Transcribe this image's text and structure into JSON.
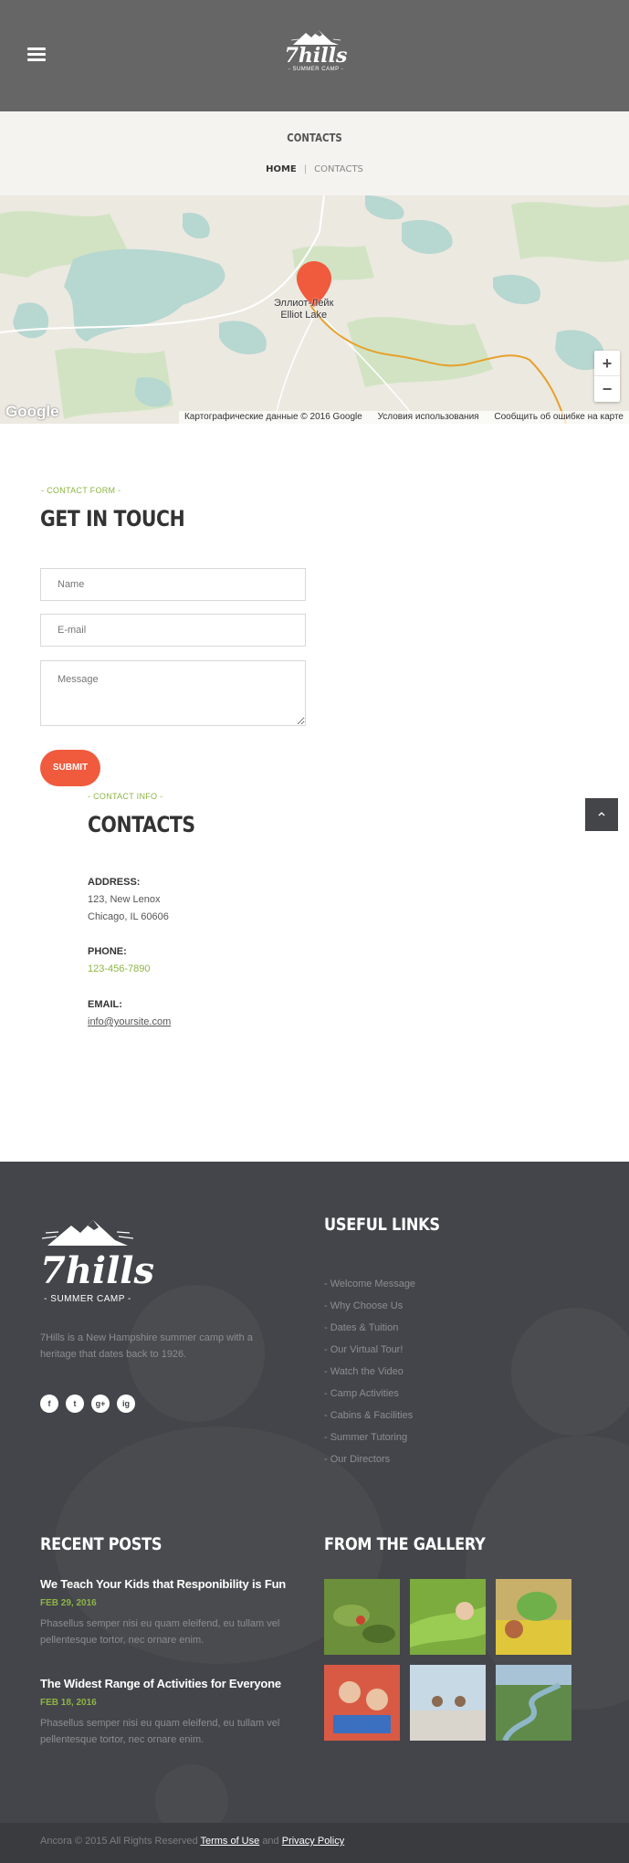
{
  "header": {
    "logo_text": "7hills",
    "logo_sub": "- SUMMER CAMP -"
  },
  "page": {
    "title": "CONTACTS",
    "breadcrumb_home": "HOME",
    "breadcrumb_sep": "|",
    "breadcrumb_current": "CONTACTS"
  },
  "map": {
    "label_ru": "Эллиот-Лейк",
    "label_en": "Elliot Lake",
    "zoom_in": "+",
    "zoom_out": "−",
    "google": "Google",
    "attribution": "Картографические данные © 2016 Google",
    "terms": "Условия использования",
    "report": "Сообщить об ошибке на карте",
    "colors": {
      "water": "#b7d7d1",
      "forest": "#d2e3c3",
      "land": "#ece9e1",
      "road": "#e6a12b",
      "pin": "#f05a3d"
    }
  },
  "contact_form": {
    "tag": "- CONTACT FORM -",
    "heading": "GET IN TOUCH",
    "name_placeholder": "Name",
    "email_placeholder": "E-mail",
    "message_placeholder": "Message",
    "submit_label": "SUBMIT"
  },
  "contact_info": {
    "tag": "- CONTACT INFO -",
    "heading": "CONTACTS",
    "address_label": "ADDRESS:",
    "address_line1": "123, New Lenox",
    "address_line2": "Chicago, IL 60606",
    "phone_label": "PHONE:",
    "phone": "123-456-7890",
    "email_label": "EMAIL:",
    "email": "info@yoursite.com"
  },
  "scroll_top_icon": "chevron-up-icon",
  "footer": {
    "logo_text": "7hills",
    "logo_sub": "- SUMMER CAMP -",
    "description": "7Hills is a New Hampshire summer camp with a heritage that dates back to 1926.",
    "socials": [
      "f",
      "t",
      "g+",
      "ig"
    ],
    "useful_heading": "USEFUL LINKS",
    "links": [
      "- Welcome Message",
      "- Why Choose Us",
      "- Dates & Tuition",
      "- Our Virtual Tour!",
      "- Watch the Video",
      "- Camp Activities",
      "- Cabins & Facilities",
      "- Summer Tutoring",
      "- Our Directors"
    ],
    "recent_heading": "RECENT POSTS",
    "posts": [
      {
        "title": "We Teach Your Kids that Responibility is Fun",
        "date": "FEB 29, 2016",
        "excerpt": "Phasellus semper nisi eu quam eleifend, eu tullam vel pellentesque tortor, nec ornare enim."
      },
      {
        "title": "The Widest Range of Activities for Everyone",
        "date": "FEB 18, 2016",
        "excerpt": "Phasellus semper nisi eu quam eleifend, eu tullam vel pellentesque tortor, nec ornare enim."
      }
    ],
    "gallery_heading": "FROM THE GALLERY",
    "copyright_prefix": "Ancora © 2015 All Rights Reserved",
    "terms": "Terms of Use",
    "and": "and",
    "privacy": "Privacy Policy"
  }
}
